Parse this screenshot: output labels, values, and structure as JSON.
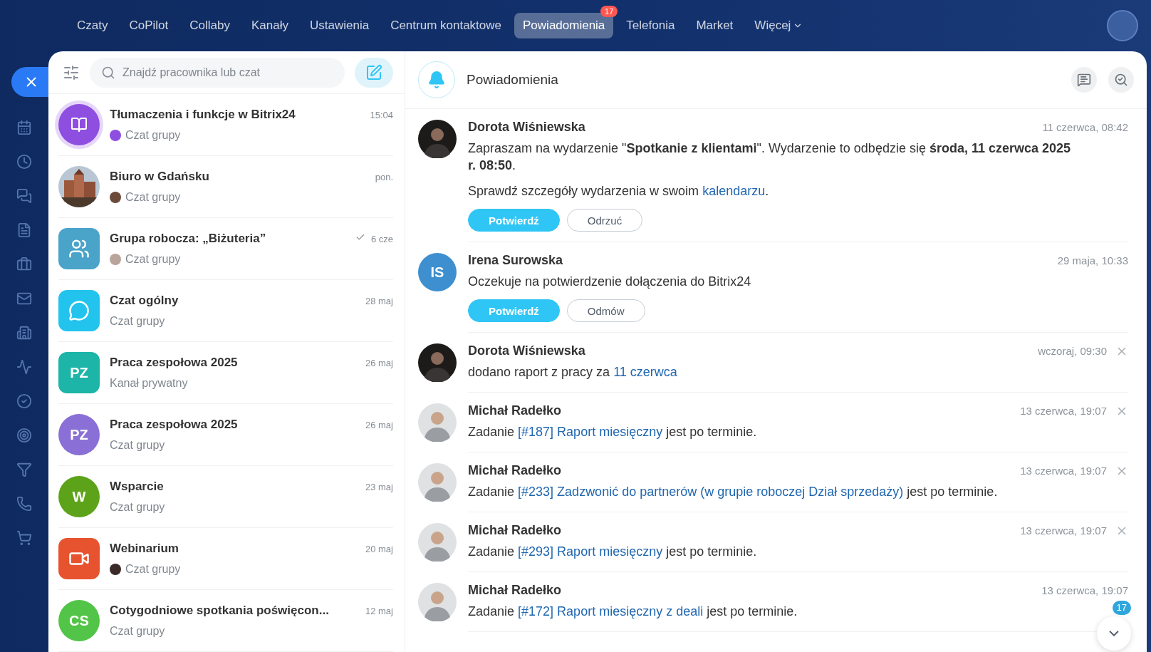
{
  "nav": {
    "items": [
      {
        "label": "Czaty",
        "selected": false
      },
      {
        "label": "CoPilot",
        "selected": false
      },
      {
        "label": "Collaby",
        "selected": false
      },
      {
        "label": "Kanały",
        "selected": false
      },
      {
        "label": "Ustawienia",
        "selected": false
      },
      {
        "label": "Centrum kontaktowe",
        "selected": false
      },
      {
        "label": "Powiadomienia",
        "selected": true,
        "badge": "17"
      },
      {
        "label": "Telefonia",
        "selected": false
      },
      {
        "label": "Market",
        "selected": false
      },
      {
        "label": "Więcej",
        "selected": false,
        "dropdown": true
      }
    ]
  },
  "search": {
    "placeholder": "Znajdź pracownika lub czat"
  },
  "chats": [
    {
      "title": "Tłumaczenia i funkcje w Bitrix24",
      "subtitle": "Czat grupy",
      "time": "15:04",
      "avatar": {
        "kind": "book",
        "color": "#8e4fe0"
      },
      "mini_avatar": {
        "color": "#8e4fe0"
      },
      "read": false
    },
    {
      "title": "Biuro w Gdańsku",
      "subtitle": "Czat grupy",
      "time": "pon.",
      "mini_avatar": {
        "color": "#6b4a3a"
      },
      "read": false
    },
    {
      "title": "Grupa robocza: „Biżuteria”",
      "subtitle": "Czat grupy",
      "time": "6 cze",
      "avatar": {
        "kind": "people",
        "color": "#4aa3c8"
      },
      "mini_avatar": {
        "color": "#b8a49a"
      },
      "read": true
    },
    {
      "title": "Czat ogólny",
      "subtitle": "Czat grupy",
      "time": "28 maj",
      "avatar": {
        "kind": "chat",
        "color": "#22c4ee"
      },
      "read": false
    },
    {
      "title": "Praca zespołowa 2025",
      "subtitle": "Kanał prywatny",
      "time": "26 maj",
      "avatar": {
        "kind": "initials-square",
        "text": "PZ",
        "color": "#1cb5a8"
      },
      "read": false
    },
    {
      "title": "Praca zespołowa 2025",
      "subtitle": "Czat grupy",
      "time": "26 maj",
      "avatar": {
        "kind": "initials-circle",
        "text": "PZ",
        "color": "#8a6fd6"
      },
      "read": false
    },
    {
      "title": "Wsparcie",
      "subtitle": "Czat grupy",
      "time": "23 maj",
      "avatar": {
        "kind": "initials-circle",
        "text": "W",
        "color": "#5da319"
      },
      "read": false
    },
    {
      "title": "Webinarium",
      "subtitle": "Czat grupy",
      "time": "20 maj",
      "avatar": {
        "kind": "video",
        "color": "#e8532f"
      },
      "mini_avatar": {
        "color": "#3a2a28"
      },
      "read": false
    },
    {
      "title": "Cotygodniowe spotkania poświęcon...",
      "subtitle": "Czat grupy",
      "time": "12 maj",
      "avatar": {
        "kind": "initials-circle",
        "text": "CS",
        "color": "#52c447"
      },
      "read": false
    }
  ],
  "panel": {
    "title": "Powiadomienia",
    "unread_badge": "17"
  },
  "notifications": [
    {
      "sender": "Dorota Wiśniewska",
      "avatar": {
        "kind": "photo-dark"
      },
      "time": "11 czerwca, 08:42",
      "closable": false,
      "paragraphs": [
        [
          {
            "kind": "text",
            "text": "Zapraszam na wydarzenie \""
          },
          {
            "kind": "bold",
            "text": "Spotkanie z klientami"
          },
          {
            "kind": "text",
            "text": "\". Wydarzenie to odbędzie się "
          },
          {
            "kind": "bold",
            "text": "środa, 11 czerwca 2025 r. 08:50"
          },
          {
            "kind": "text",
            "text": "."
          }
        ],
        [
          {
            "kind": "text",
            "text": "Sprawdź szczegóły wydarzenia w swoim "
          },
          {
            "kind": "link",
            "text": "kalendarzu"
          },
          {
            "kind": "text",
            "text": "."
          }
        ]
      ],
      "actions": [
        {
          "label": "Potwierdź",
          "kind": "primary"
        },
        {
          "label": "Odrzuć",
          "kind": "secondary"
        }
      ]
    },
    {
      "sender": "Irena Surowska",
      "avatar": {
        "kind": "initials-circle",
        "text": "IS",
        "color": "#3d8fcf"
      },
      "time": "29 maja, 10:33",
      "closable": false,
      "paragraphs": [
        [
          {
            "kind": "text",
            "text": "Oczekuje na potwierdzenie dołączenia do Bitrix24"
          }
        ]
      ],
      "actions": [
        {
          "label": "Potwierdź",
          "kind": "primary"
        },
        {
          "label": "Odmów",
          "kind": "secondary"
        }
      ]
    },
    {
      "sender": "Dorota Wiśniewska",
      "avatar": {
        "kind": "photo-dark"
      },
      "time": "wczoraj, 09:30",
      "closable": true,
      "paragraphs": [
        [
          {
            "kind": "text",
            "text": "dodano raport z pracy za "
          },
          {
            "kind": "link",
            "text": "11 czerwca"
          }
        ]
      ]
    },
    {
      "sender": "Michał Radełko",
      "avatar": {
        "kind": "photo-light"
      },
      "time": "13 czerwca, 19:07",
      "closable": true,
      "paragraphs": [
        [
          {
            "kind": "text",
            "text": "Zadanie "
          },
          {
            "kind": "link",
            "text": "[#187] Raport miesięczny"
          },
          {
            "kind": "text",
            "text": " jest po terminie."
          }
        ]
      ]
    },
    {
      "sender": "Michał Radełko",
      "avatar": {
        "kind": "photo-light"
      },
      "time": "13 czerwca, 19:07",
      "closable": true,
      "paragraphs": [
        [
          {
            "kind": "text",
            "text": "Zadanie "
          },
          {
            "kind": "link",
            "text": "[#233] Zadzwonić do partnerów (w grupie roboczej Dział sprzedaży)"
          },
          {
            "kind": "text",
            "text": " jest po terminie."
          }
        ]
      ]
    },
    {
      "sender": "Michał Radełko",
      "avatar": {
        "kind": "photo-light"
      },
      "time": "13 czerwca, 19:07",
      "closable": true,
      "paragraphs": [
        [
          {
            "kind": "text",
            "text": "Zadanie "
          },
          {
            "kind": "link",
            "text": "[#293] Raport miesięczny"
          },
          {
            "kind": "text",
            "text": " jest po terminie."
          }
        ]
      ]
    },
    {
      "sender": "Michał Radełko",
      "avatar": {
        "kind": "photo-light"
      },
      "time": "13 czerwca, 19:07",
      "closable": false,
      "paragraphs": [
        [
          {
            "kind": "text",
            "text": "Zadanie "
          },
          {
            "kind": "link",
            "text": "[#172] Raport miesięczny z deali"
          },
          {
            "kind": "text",
            "text": " jest po terminie."
          }
        ]
      ]
    }
  ]
}
